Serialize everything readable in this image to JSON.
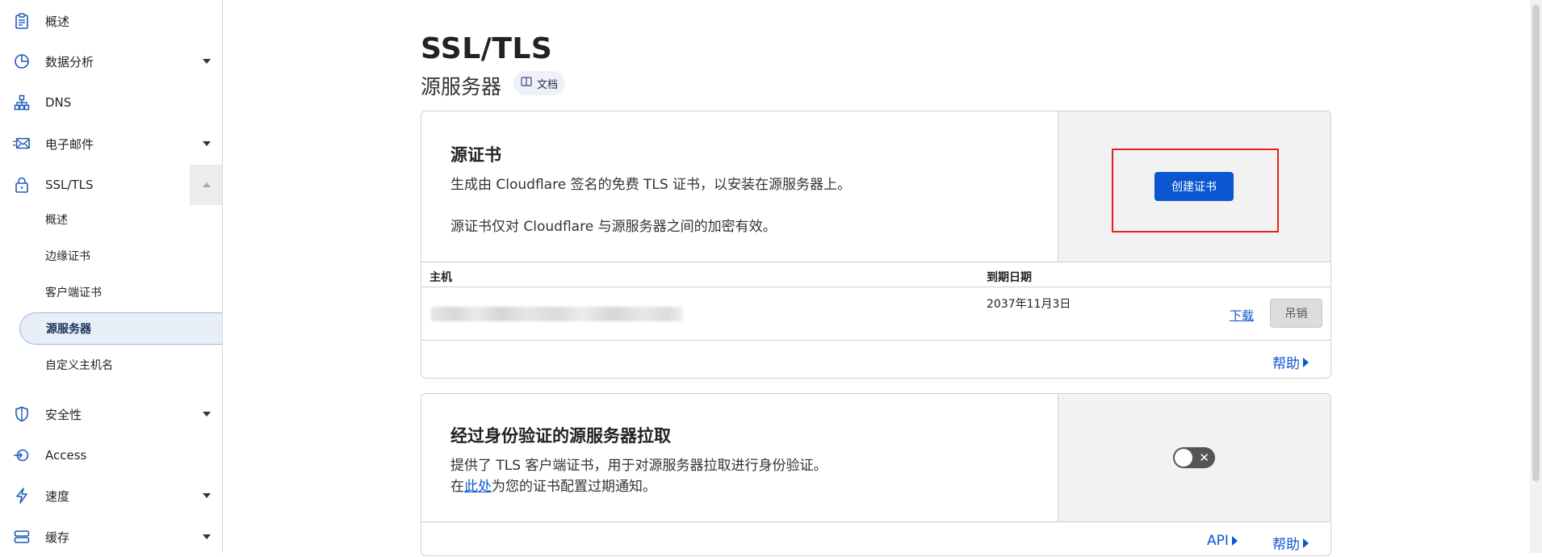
{
  "sidebar": {
    "items": [
      {
        "label": "概述",
        "icon": "clipboard-icon"
      },
      {
        "label": "数据分析",
        "icon": "pie-chart-icon"
      },
      {
        "label": "DNS",
        "icon": "network-icon"
      },
      {
        "label": "电子邮件",
        "icon": "envelope-icon"
      },
      {
        "label": "SSL/TLS",
        "icon": "lock-icon"
      },
      {
        "label": "安全性",
        "icon": "shield-icon"
      },
      {
        "label": "Access",
        "icon": "access-icon"
      },
      {
        "label": "速度",
        "icon": "lightning-icon"
      },
      {
        "label": "缓存",
        "icon": "database-icon"
      }
    ],
    "sub_items": [
      {
        "label": "概述"
      },
      {
        "label": "边缘证书"
      },
      {
        "label": "客户端证书"
      },
      {
        "label": "源服务器"
      },
      {
        "label": "自定义主机名"
      }
    ]
  },
  "header": {
    "title": "SSL/TLS",
    "subtitle": "源服务器",
    "doc_label": "文档"
  },
  "origin_cert": {
    "title": "源证书",
    "desc1": "生成由 Cloudflare 签名的免费 TLS 证书，以安装在源服务器上。",
    "desc2": "源证书仅对 Cloudflare 与源服务器之间的加密有效。",
    "create_label": "创建证书",
    "table": {
      "col_host": "主机",
      "col_expiry": "到期日期",
      "rows": [
        {
          "expiry": "2037年11月3日",
          "download": "下载",
          "revoke": "吊销"
        }
      ]
    },
    "help": "帮助"
  },
  "authenticated_pull": {
    "title": "经过身份验证的源服务器拉取",
    "desc1": "提供了 TLS 客户端证书，用于对源服务器拉取进行身份验证。",
    "desc2_prefix": "在",
    "desc2_link": "此处",
    "desc2_suffix": "为您的证书配置过期通知。",
    "toggle_state": "off",
    "api": "API",
    "help": "帮助"
  },
  "colors": {
    "accent": "#0b57d0",
    "highlight": "#e62020",
    "active_bg": "#e8eef8"
  }
}
